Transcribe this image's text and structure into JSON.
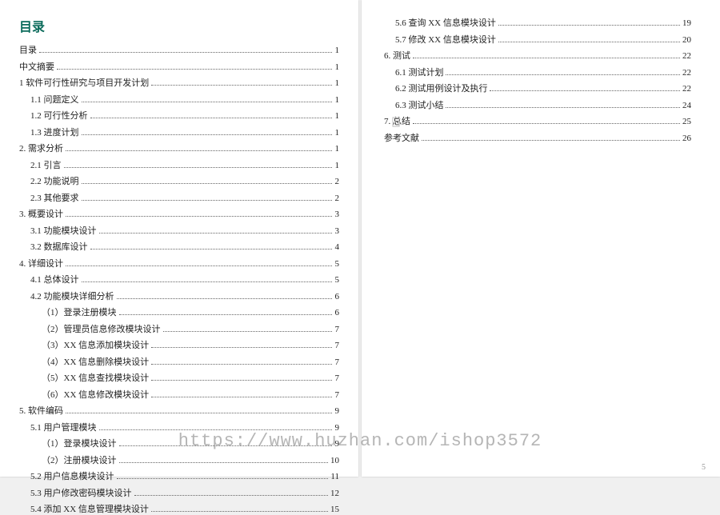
{
  "title": "目录",
  "left_entries": [
    {
      "label": "目录",
      "page": "1",
      "indent": 0
    },
    {
      "label": "中文摘要",
      "page": "1",
      "indent": 0
    },
    {
      "label": "1 软件可行性研究与项目开发计划",
      "page": "1",
      "indent": 0
    },
    {
      "label": "1.1 问题定义",
      "page": "1",
      "indent": 1
    },
    {
      "label": "1.2 可行性分析",
      "page": "1",
      "indent": 1
    },
    {
      "label": "1.3 进度计划",
      "page": "1",
      "indent": 1
    },
    {
      "label": "2. 需求分析",
      "page": "1",
      "indent": 0
    },
    {
      "label": "2.1 引言",
      "page": "1",
      "indent": 1
    },
    {
      "label": "2.2 功能说明",
      "page": "2",
      "indent": 1
    },
    {
      "label": "2.3 其他要求",
      "page": "2",
      "indent": 1
    },
    {
      "label": "3. 概要设计",
      "page": "3",
      "indent": 0
    },
    {
      "label": "3.1 功能模块设计",
      "page": "3",
      "indent": 1
    },
    {
      "label": "3.2 数据库设计",
      "page": "4",
      "indent": 1
    },
    {
      "label": "4. 详细设计",
      "page": "5",
      "indent": 0
    },
    {
      "label": "4.1 总体设计",
      "page": "5",
      "indent": 1
    },
    {
      "label": "4.2 功能模块详细分析",
      "page": "6",
      "indent": 1
    },
    {
      "label": "（1）登录注册模块",
      "page": "6",
      "indent": 2
    },
    {
      "label": "（2）管理员信息修改模块设计",
      "page": "7",
      "indent": 2
    },
    {
      "label": "（3）XX 信息添加模块设计",
      "page": "7",
      "indent": 2
    },
    {
      "label": "（4）XX 信息删除模块设计",
      "page": "7",
      "indent": 2
    },
    {
      "label": "（5）XX 信息查找模块设计",
      "page": "7",
      "indent": 2
    },
    {
      "label": "（6）XX 信息修改模块设计",
      "page": "7",
      "indent": 2
    },
    {
      "label": "5. 软件编码",
      "page": "9",
      "indent": 0
    },
    {
      "label": "5.1 用户管理模块",
      "page": "9",
      "indent": 1
    },
    {
      "label": "（1）登录模块设计",
      "page": "9",
      "indent": 2
    },
    {
      "label": "（2）注册模块设计",
      "page": "10",
      "indent": 2
    },
    {
      "label": "5.2 用户信息模块设计",
      "page": "11",
      "indent": 1
    },
    {
      "label": "5.3 用户修改密码模块设计",
      "page": "12",
      "indent": 1
    },
    {
      "label": "5.4 添加 XX 信息管理模块设计",
      "page": "15",
      "indent": 1
    }
  ],
  "right_entries": [
    {
      "label": "5.6 查询 XX 信息模块设计",
      "page": "19",
      "indent": 1
    },
    {
      "label": "5.7 修改 XX 信息模块设计",
      "page": "20",
      "indent": 1
    },
    {
      "label": "6. 测试",
      "page": "22",
      "indent": 0
    },
    {
      "label": "6.1 测试计划",
      "page": "22",
      "indent": 1
    },
    {
      "label": "6.2 测试用例设计及执行",
      "page": "22",
      "indent": 1
    },
    {
      "label": "6.3 测试小结",
      "page": "24",
      "indent": 1
    },
    {
      "label": "7. 总结",
      "page": "25",
      "indent": 0
    },
    {
      "label": "参考文献",
      "page": "26",
      "indent": 0
    }
  ],
  "watermark": "https://www.huzhan.com/ishop3572",
  "footer_right": "5",
  "page_break_mark": "·"
}
